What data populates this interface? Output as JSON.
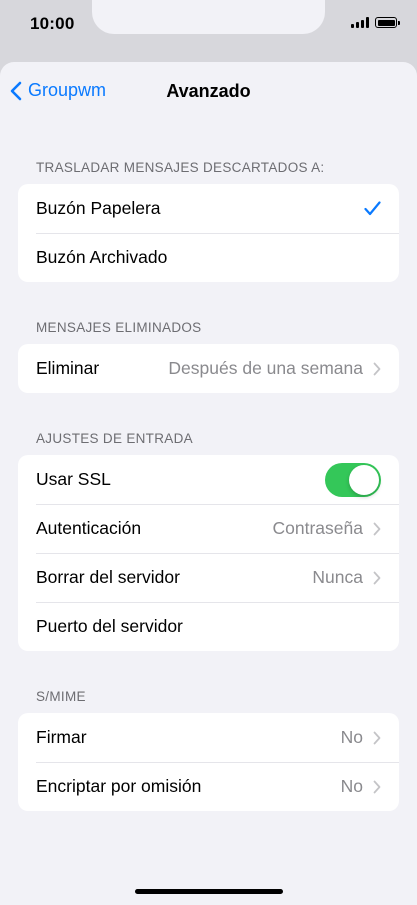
{
  "status_bar": {
    "time": "10:00",
    "signal_icon": "signal-icon",
    "battery_icon": "battery-icon"
  },
  "navigation": {
    "back_label": "Groupwm",
    "title": "Avanzado"
  },
  "sections": {
    "discarded": {
      "header": "TRASLADAR MENSAJES DESCARTADOS A:",
      "items": [
        {
          "label": "Buzón Papelera",
          "checked": true
        },
        {
          "label": "Buzón Archivado",
          "checked": false
        }
      ]
    },
    "deleted": {
      "header": "MENSAJES ELIMINADOS",
      "items": [
        {
          "label": "Eliminar",
          "value": "Después de una semana"
        }
      ]
    },
    "incoming": {
      "header": "AJUSTES DE ENTRADA",
      "items": [
        {
          "label": "Usar SSL",
          "toggle_on": true
        },
        {
          "label": "Autenticación",
          "value": "Contraseña"
        },
        {
          "label": "Borrar del servidor",
          "value": "Nunca"
        },
        {
          "label": "Puerto del servidor"
        }
      ]
    },
    "smime": {
      "header": "S/MIME",
      "items": [
        {
          "label": "Firmar",
          "value": "No"
        },
        {
          "label": "Encriptar por omisión",
          "value": "No"
        }
      ]
    }
  },
  "colors": {
    "accent": "#0a7aff",
    "toggle_on": "#34c759",
    "background": "#f2f2f7",
    "secondary_text": "#8a8a8e",
    "section_header": "#6d6d72"
  }
}
